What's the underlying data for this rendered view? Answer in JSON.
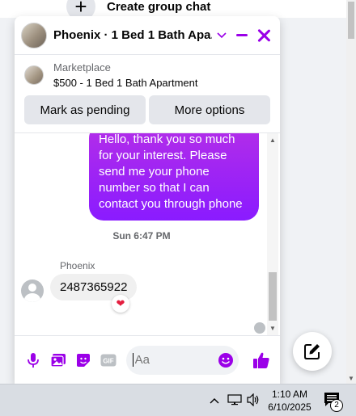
{
  "page": {
    "create_group_label": "Create group chat",
    "plus_icon": "plus-icon"
  },
  "chat": {
    "title": "Phoenix · 1 Bed 1 Bath Apa...",
    "accent_color": "#9b00e8",
    "marketplace": {
      "source": "Marketplace",
      "listing": "$500 - 1 Bed 1 Bath Apartment",
      "pending_label": "Mark as pending",
      "more_label": "More options"
    },
    "messages": {
      "outgoing_text": "Hello, thank you so much for your interest. Please send me your phone number so that I can contact you through phone",
      "timestamp": "Sun 6:47 PM",
      "sender_name": "Phoenix",
      "incoming_text": "2487365922",
      "reaction": "❤"
    },
    "composer": {
      "placeholder": "Aa",
      "gif_label": "GIF"
    }
  },
  "taskbar": {
    "time": "1:10 AM",
    "date": "6/10/2025",
    "notification_count": "2"
  }
}
